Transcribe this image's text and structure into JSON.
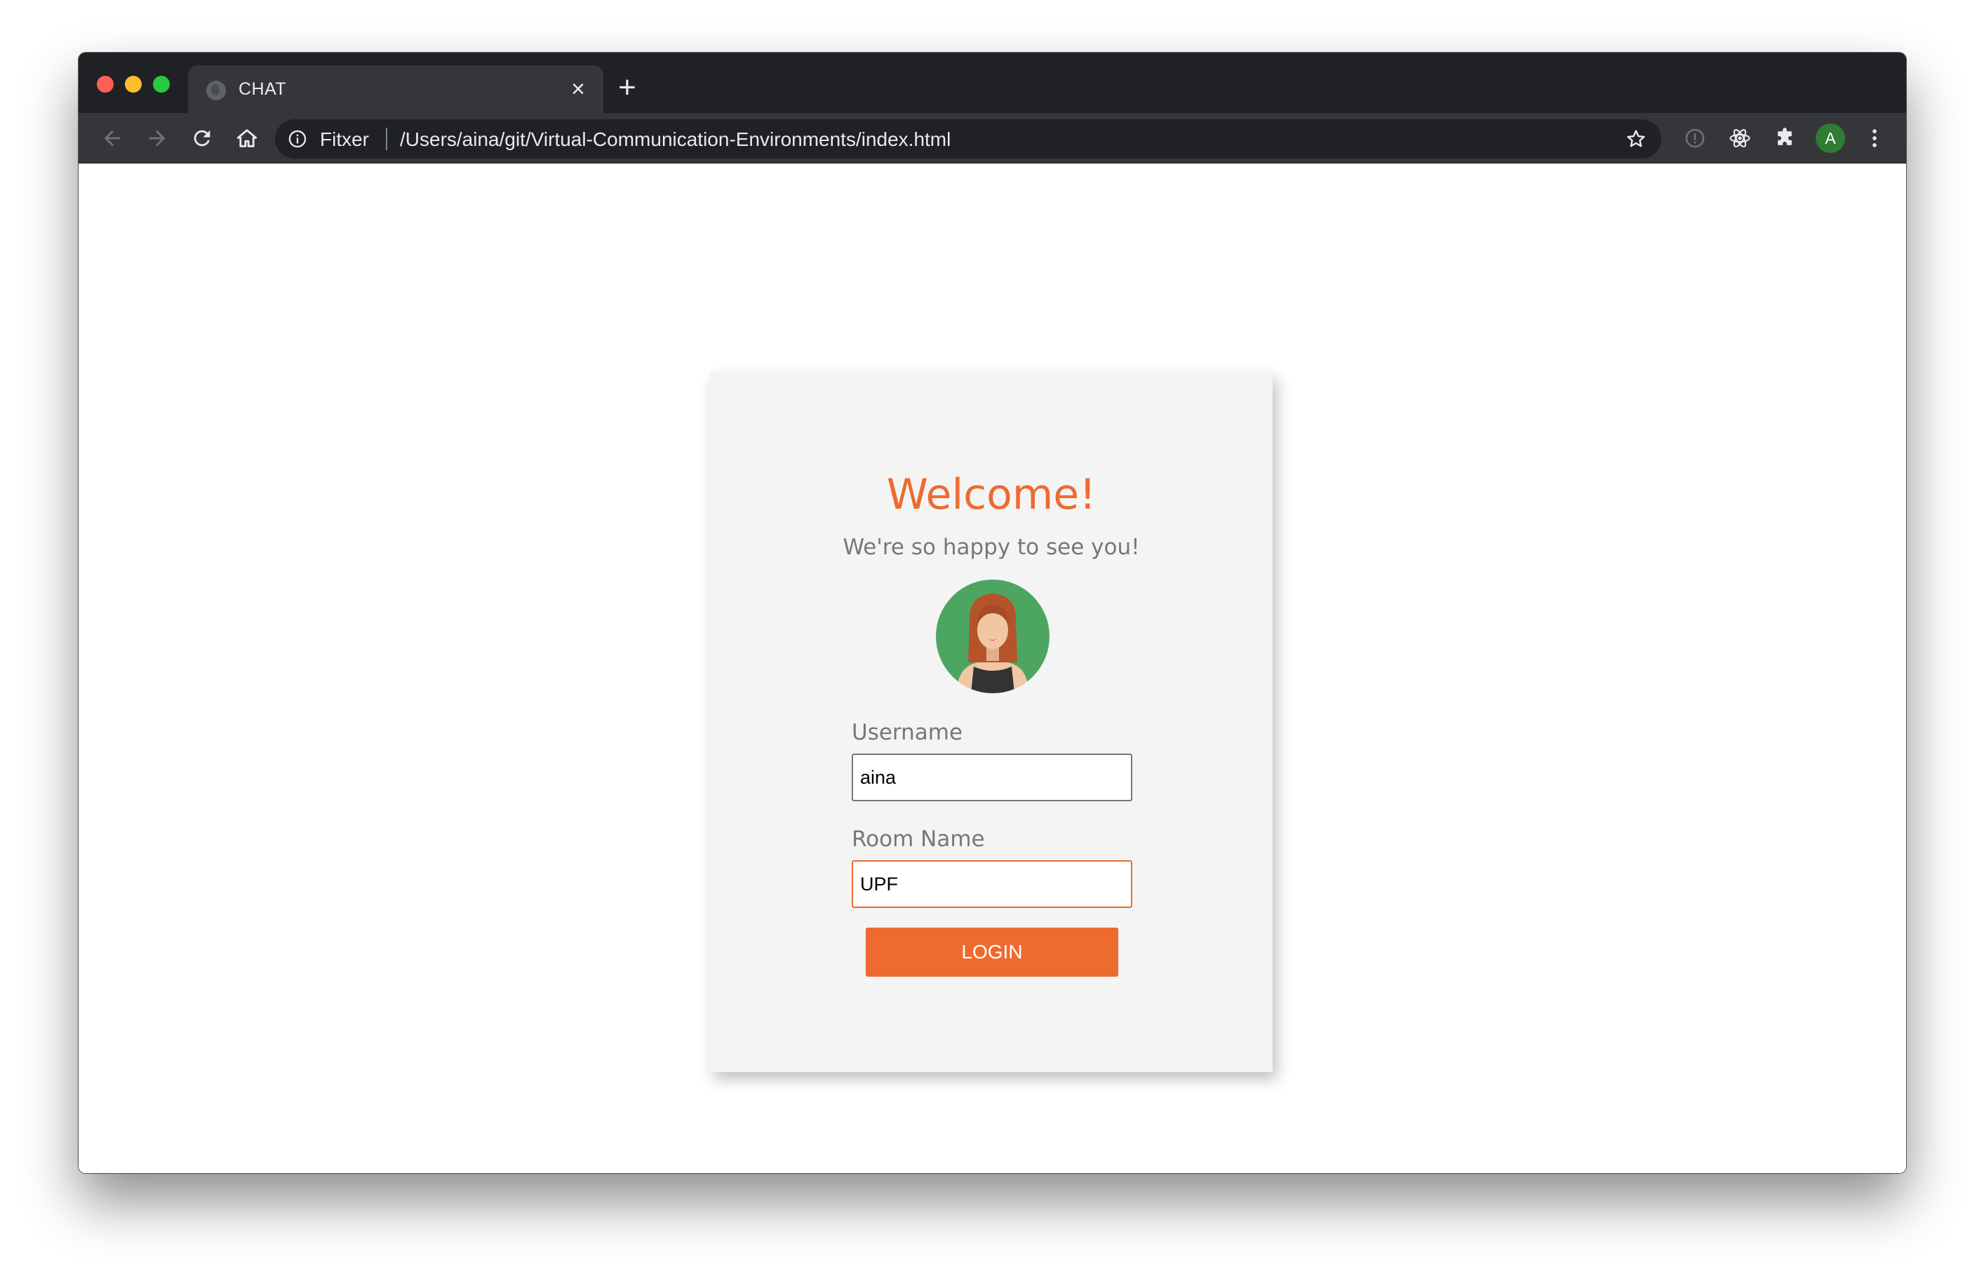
{
  "browser": {
    "tab": {
      "title": "CHAT",
      "close_icon": "×"
    },
    "new_tab_icon": "+",
    "omnibox": {
      "site_label": "Fitxer",
      "url": "/Users/aina/git/Virtual-Communication-Environments/index.html"
    },
    "profile_initial": "A",
    "colors": {
      "frame": "#202124",
      "toolbar": "#35363a",
      "profile": "#2e7d32"
    }
  },
  "login": {
    "title": "Welcome!",
    "subtitle": "We're so happy to see you!",
    "username_label": "Username",
    "username_value": "aina",
    "room_label": "Room Name",
    "room_value": "UPF",
    "button_label": "LOGIN",
    "accent_color": "#ed6b2f"
  }
}
